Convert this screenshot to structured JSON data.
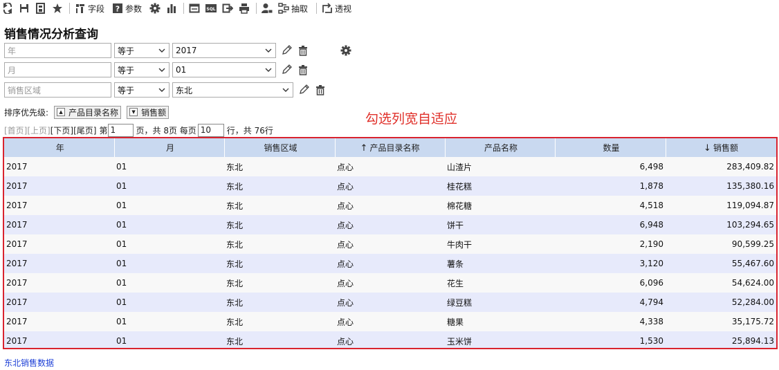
{
  "toolbar": {
    "field_label": "字段",
    "param_label": "参数",
    "extract_label": "抽取",
    "pivot_label": "透视"
  },
  "page": {
    "title": "销售情况分析查询"
  },
  "filters": [
    {
      "placeholder": "年",
      "operator": "等于",
      "value": "2017"
    },
    {
      "placeholder": "月",
      "operator": "等于",
      "value": "01"
    },
    {
      "placeholder": "销售区域",
      "operator": "等于",
      "value": "东北"
    }
  ],
  "sort": {
    "label": "排序优先级:",
    "items": [
      {
        "label": "产品目录名称",
        "direction": "asc"
      },
      {
        "label": "销售额",
        "direction": "desc"
      }
    ]
  },
  "annotation": "勾选列宽自适应",
  "pager": {
    "first": "[首页]",
    "prev": "[上页]",
    "next": "[下页]",
    "last": "[尾页]",
    "page_prefix": "第",
    "page_value": "1",
    "page_suffix": "页，共 8页 每页",
    "size_value": "10",
    "size_suffix": "行，共 76行"
  },
  "table": {
    "columns": [
      "年",
      "月",
      "销售区域",
      "产品目录名称",
      "产品名称",
      "数量",
      "销售额"
    ],
    "sort_marks": [
      "",
      "",
      "",
      "↑",
      "",
      "",
      "↓"
    ],
    "rows": [
      [
        "2017",
        "01",
        "东北",
        "点心",
        "山渣片",
        "6,498",
        "283,409.82"
      ],
      [
        "2017",
        "01",
        "东北",
        "点心",
        "桂花糕",
        "1,878",
        "135,380.16"
      ],
      [
        "2017",
        "01",
        "东北",
        "点心",
        "棉花糖",
        "4,518",
        "119,094.87"
      ],
      [
        "2017",
        "01",
        "东北",
        "点心",
        "饼干",
        "6,948",
        "103,294.65"
      ],
      [
        "2017",
        "01",
        "东北",
        "点心",
        "牛肉干",
        "2,190",
        "90,599.25"
      ],
      [
        "2017",
        "01",
        "东北",
        "点心",
        "薯条",
        "3,120",
        "55,467.60"
      ],
      [
        "2017",
        "01",
        "东北",
        "点心",
        "花生",
        "6,096",
        "54,624.00"
      ],
      [
        "2017",
        "01",
        "东北",
        "点心",
        "绿豆糕",
        "4,794",
        "52,284.00"
      ],
      [
        "2017",
        "01",
        "东北",
        "点心",
        "糖果",
        "4,338",
        "35,175.72"
      ],
      [
        "2017",
        "01",
        "东北",
        "点心",
        "玉米饼",
        "1,530",
        "25,894.13"
      ]
    ]
  },
  "footer": {
    "link": "东北销售数据"
  }
}
